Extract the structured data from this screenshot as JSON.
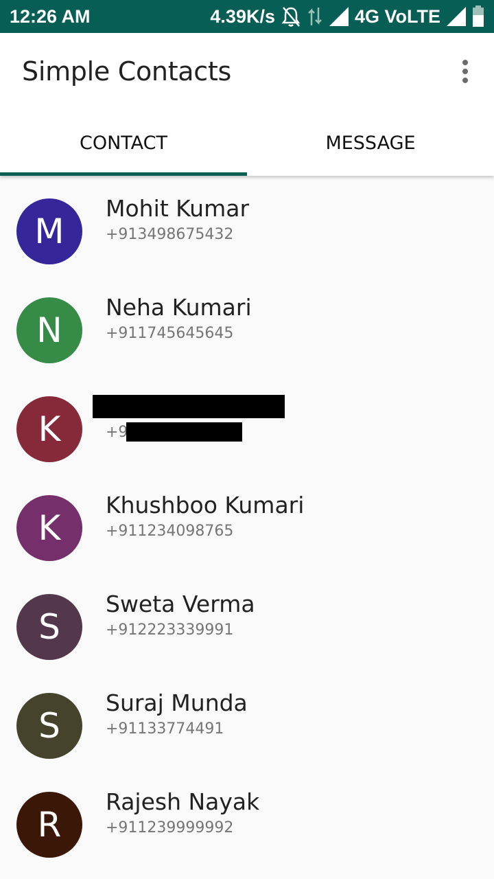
{
  "status_bar": {
    "time": "12:26 AM",
    "speed": "4.39K/s",
    "network": "4G VoLTE",
    "icons": [
      "bell-off-icon",
      "data-transfer-icon",
      "signal-icon",
      "battery-icon"
    ]
  },
  "app_bar": {
    "title": "Simple Contacts",
    "menu_icon": "overflow-menu-icon"
  },
  "tabs": [
    {
      "label": "CONTACT",
      "active": true
    },
    {
      "label": "MESSAGE",
      "active": false
    }
  ],
  "contacts": [
    {
      "initial": "M",
      "name": "Mohit Kumar",
      "phone": "+913498675432",
      "color": "#35279a"
    },
    {
      "initial": "N",
      "name": "Neha Kumari",
      "phone": "+911745645645",
      "color": "#368c46"
    },
    {
      "initial": "K",
      "name": "",
      "phone": "+91",
      "color": "#862a3a",
      "redacted": true
    },
    {
      "initial": "K",
      "name": "Khushboo Kumari",
      "phone": "+911234098765",
      "color": "#752f6a"
    },
    {
      "initial": "S",
      "name": "Sweta Verma",
      "phone": "+912223339991",
      "color": "#53384c"
    },
    {
      "initial": "S",
      "name": "Suraj Munda",
      "phone": "+91133774491",
      "color": "#45432b"
    },
    {
      "initial": "R",
      "name": "Rajesh Nayak",
      "phone": "+911239999992",
      "color": "#3a1706"
    }
  ],
  "colors": {
    "primary": "#075e54",
    "background": "#fafafa"
  }
}
